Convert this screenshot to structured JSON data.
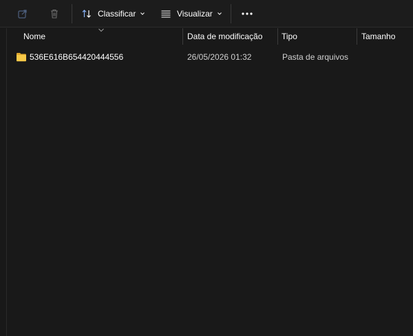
{
  "toolbar": {
    "share_icon": "share-icon",
    "delete_icon": "trash-icon",
    "sort_label": "Classificar",
    "view_label": "Visualizar",
    "more_icon": "ellipsis-icon"
  },
  "columns": {
    "name": "Nome",
    "date": "Data de modificação",
    "type": "Tipo",
    "size": "Tamanho"
  },
  "rows": [
    {
      "name": "536E616B654420444556",
      "date": "26/05/2026 01:32",
      "type": "Pasta de arquivos",
      "size": "",
      "icon": "folder-icon"
    }
  ],
  "colors": {
    "background": "#191919",
    "folder": "#f2c94c"
  }
}
